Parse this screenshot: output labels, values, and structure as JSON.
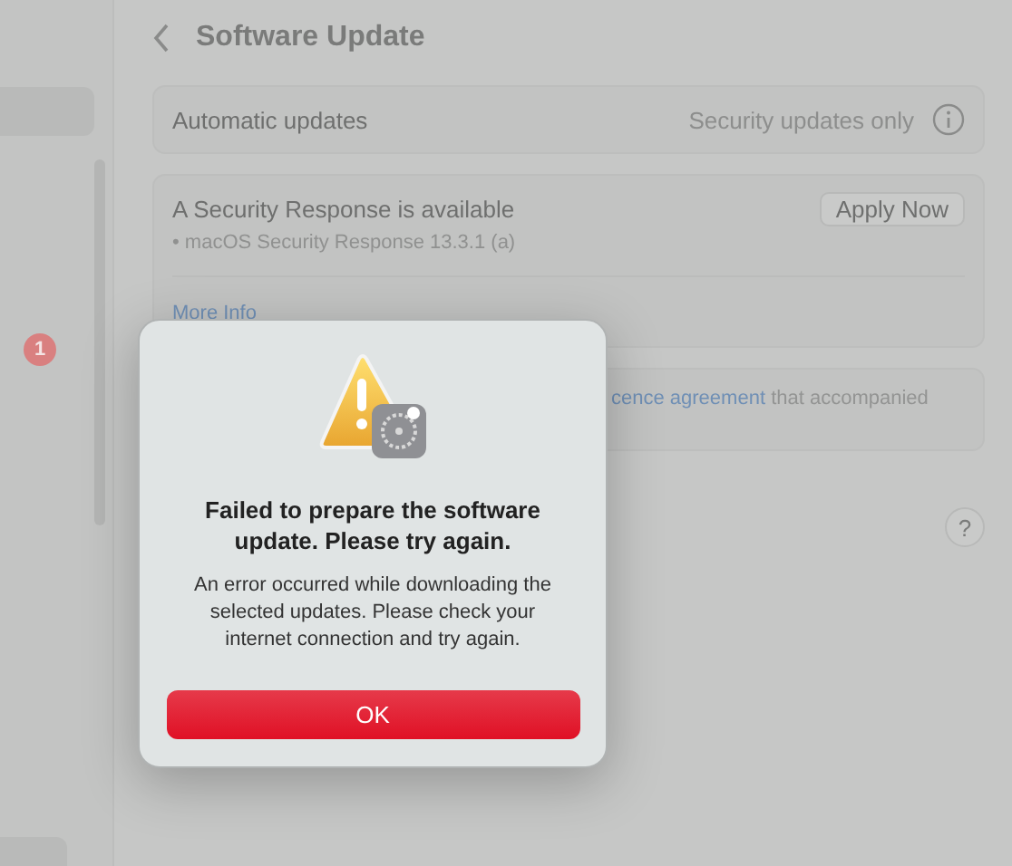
{
  "sidebar": {
    "badge": "1"
  },
  "header": {
    "title": "Software Update"
  },
  "automatic_updates": {
    "label": "Automatic updates",
    "value": "Security updates only"
  },
  "security_response": {
    "title": "A Security Response is available",
    "button": "Apply Now",
    "items": [
      "• macOS Security Response 13.3.1 (a)"
    ],
    "link": "More Info"
  },
  "licence": {
    "link": "cence agreement",
    "text": "that accompanied"
  },
  "help_button": "?",
  "alert": {
    "title": "Failed to prepare the software update. Please try again.",
    "message": "An error occurred while downloading the selected updates. Please check your internet connection and try again.",
    "button": "OK"
  }
}
